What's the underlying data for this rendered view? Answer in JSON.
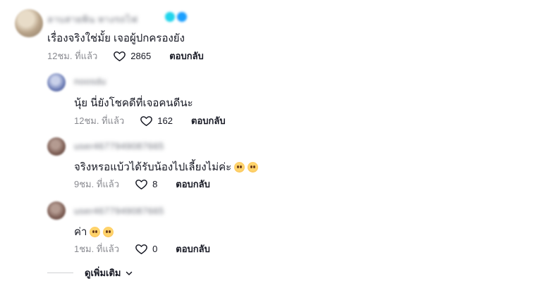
{
  "comments": [
    {
      "username": "ลาบสายพิน ทางรถไฟ",
      "text": "เรื่องจริงใช่มั้ย เจอผู้ปกครองยัง",
      "emoji_count": 0,
      "time": "12ชม. ที่แล้ว",
      "likes": "2865",
      "reply_label": "ตอบกลับ"
    },
    {
      "username": "noosdu",
      "text": "นุ้ย นี่ยังโชคดีที่เจอคนดีนะ",
      "emoji_count": 0,
      "time": "12ชม. ที่แล้ว",
      "likes": "162",
      "reply_label": "ตอบกลับ"
    },
    {
      "username": "user4677949087665",
      "text": "จริงหรอแบ้วได้รับน้องไปเลี้ยงไม่ค่ะ",
      "emoji_count": 2,
      "time": "9ชม. ที่แล้ว",
      "likes": "8",
      "reply_label": "ตอบกลับ"
    },
    {
      "username": "user4677949087665",
      "text": "ค่า",
      "emoji_count": 2,
      "time": "1ชม. ที่แล้ว",
      "likes": "0",
      "reply_label": "ตอบกลับ"
    }
  ],
  "more": {
    "label": "ดูเพิ่มเติม"
  },
  "icons": {
    "like": "heart-outline-icon",
    "expand": "chevron-down-icon",
    "emoji": "pleading-face-emoji"
  },
  "colors": {
    "text": "#161823",
    "muted": "#8a8b91",
    "verified": "#20d5ec"
  }
}
